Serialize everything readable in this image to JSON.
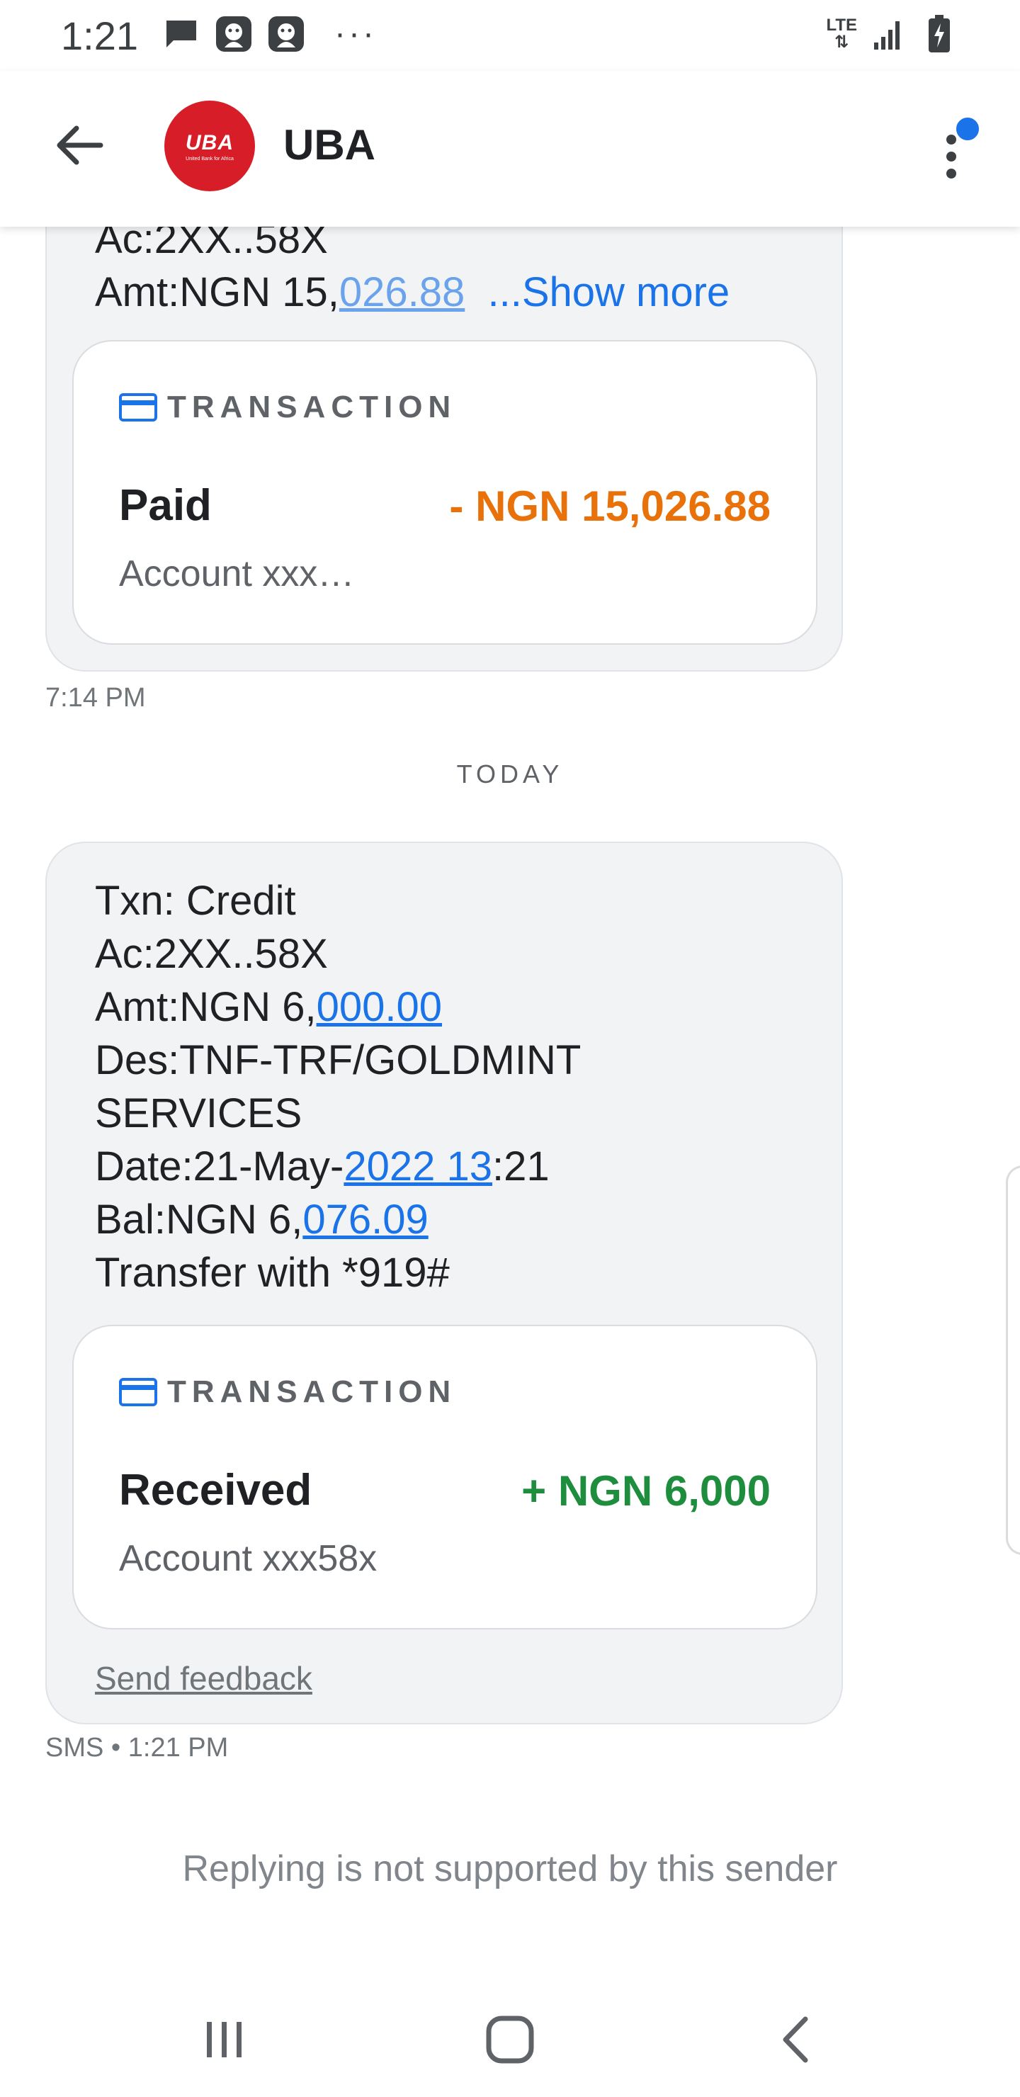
{
  "status_bar": {
    "time": "1:21",
    "left_icons": [
      "message-icon",
      "app-notification-icon",
      "app-notification-icon"
    ],
    "overflow": "···",
    "network": "LTE",
    "right_icons": [
      "lte-icon",
      "signal-icon",
      "battery-charging-icon"
    ]
  },
  "app_bar": {
    "back_icon": "arrow-back-icon",
    "logo_text": "UBA",
    "logo_subtext": "United Bank for Africa",
    "sender": "UBA",
    "more_icon": "more-vert-icon",
    "badge_color": "#1a73e8"
  },
  "messages": [
    {
      "lines": [
        {
          "text": "Ac:2XX..58X"
        },
        {
          "prefix": "Amt:NGN 15,",
          "link": "026.88",
          "suffix": ""
        }
      ],
      "show_more": "...Show more",
      "card": {
        "label": "TRANSACTION",
        "title": "Paid",
        "amount": "- NGN 15,026.88",
        "amount_color": "#e8710a",
        "account": "Account xxx…"
      },
      "time": "7:14 PM"
    },
    {
      "lines": [
        {
          "text": "Txn: Credit"
        },
        {
          "text": "Ac:2XX..58X"
        },
        {
          "prefix": "Amt:NGN 6,",
          "link": "000.00",
          "suffix": ""
        },
        {
          "text": "Des:TNF-TRF/GOLDMINT"
        },
        {
          "text": "SERVICES"
        },
        {
          "prefix": "Date:21-May-",
          "link": "2022 13",
          "suffix": ":21"
        },
        {
          "prefix": "Bal:NGN 6,",
          "link": "076.09",
          "suffix": ""
        },
        {
          "text": "Transfer with *919#"
        }
      ],
      "card": {
        "label": "TRANSACTION",
        "title": "Received",
        "amount": "+ NGN 6,000",
        "amount_color": "#1e8e3e",
        "account": "Account xxx58x"
      },
      "feedback": "Send feedback",
      "time": "SMS • 1:21 PM"
    }
  ],
  "date_divider": "TODAY",
  "reply_note": "Replying is not supported by this sender",
  "nav": {
    "recents_icon": "recent-apps-icon",
    "home_icon": "home-icon",
    "back_icon": "nav-back-icon"
  }
}
